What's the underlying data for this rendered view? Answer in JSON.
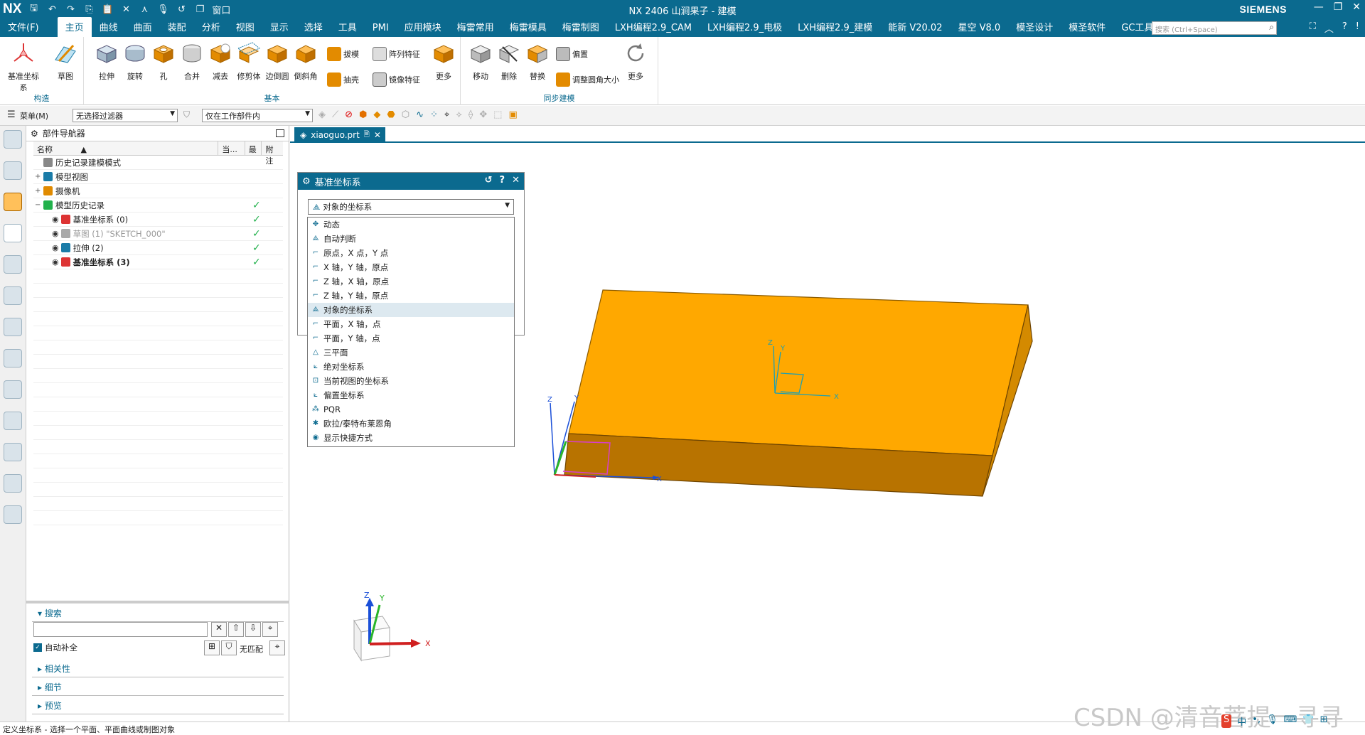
{
  "titlebar": {
    "logo": "NX",
    "title": "NX 2406 山涧果子 - 建模",
    "brand": "SIEMENS",
    "window_label": "窗口"
  },
  "menu": {
    "items": [
      "文件(F)",
      "主页",
      "曲线",
      "曲面",
      "装配",
      "分析",
      "视图",
      "显示",
      "选择",
      "工具",
      "PMI",
      "应用模块",
      "梅雷常用",
      "梅雷模具",
      "梅雷制图",
      "LXH编程2.9_CAM",
      "LXH编程2.9_电极",
      "LXH编程2.9_建模",
      "能新 V20.02",
      "星空 V8.0",
      "模圣设计",
      "模圣软件",
      "GC工具箱"
    ],
    "active_index": 1,
    "search_placeholder": "搜索 (Ctrl+Space)"
  },
  "ribbon": {
    "construct": {
      "label": "构造",
      "buttons": [
        "基准坐标系",
        "草图"
      ]
    },
    "basic": {
      "label": "基本",
      "buttons": [
        "拉伸",
        "旋转",
        "孔",
        "合并",
        "减去",
        "修剪体",
        "边倒圆",
        "倒斜角"
      ],
      "small": [
        "拔模",
        "阵列特征",
        "抽壳",
        "镜像特征"
      ],
      "more": "更多"
    },
    "sync": {
      "label": "同步建模",
      "buttons": [
        "移动",
        "删除",
        "替换"
      ],
      "small": [
        "偏置",
        "调整圆角大小"
      ],
      "more": "更多"
    }
  },
  "toolbar2": {
    "menu": "菜单(M)",
    "filter": "无选择过滤器",
    "scope": "仅在工作部件内"
  },
  "navigator": {
    "title": "部件导航器",
    "columns": [
      "名称",
      "当...",
      "最",
      "附注"
    ],
    "rows": [
      {
        "label": "历史记录建模模式",
        "indent": 1,
        "check": false
      },
      {
        "label": "模型视图",
        "indent": 0,
        "check": false
      },
      {
        "label": "摄像机",
        "indent": 0,
        "check": false
      },
      {
        "label": "模型历史记录",
        "indent": 0,
        "check": true
      },
      {
        "label": "基准坐标系 (0)",
        "indent": 2,
        "check": true
      },
      {
        "label": "草图 (1) \"SKETCH_000\"",
        "indent": 2,
        "check": true,
        "dim": true
      },
      {
        "label": "拉伸 (2)",
        "indent": 2,
        "check": true
      },
      {
        "label": "基准坐标系 (3)",
        "indent": 2,
        "check": true,
        "bold": true
      }
    ],
    "search_label": "搜索",
    "autocomplete": "自动补全",
    "no_match": "无匹配",
    "sections": [
      "相关性",
      "细节",
      "预览"
    ]
  },
  "tab": {
    "name": "xiaoguo.prt"
  },
  "dialog": {
    "title": "基准坐标系",
    "selected": "对象的坐标系",
    "options": [
      "动态",
      "自动判断",
      "原点，X 点，Y 点",
      "X 轴，Y 轴，原点",
      "Z 轴，X 轴，原点",
      "Z 轴，Y 轴，原点",
      "对象的坐标系",
      "平面，X 轴，点",
      "平面，Y 轴，点",
      "三平面",
      "绝对坐标系",
      "当前视图的坐标系",
      "偏置坐标系",
      "PQR",
      "欧拉/泰特布莱恩角",
      "显示快捷方式"
    ],
    "selected_index": 6
  },
  "axes": {
    "x": "X",
    "y": "Y",
    "z": "Z"
  },
  "status": "定义坐标系 - 选择一个平面、平面曲线或制图对象",
  "watermark": "CSDN @清音菩提一寻寻",
  "colors": {
    "accent": "#0b6a8f",
    "body_top": "#ffa800",
    "body_front": "#b87300",
    "body_side": "#d48a00"
  }
}
